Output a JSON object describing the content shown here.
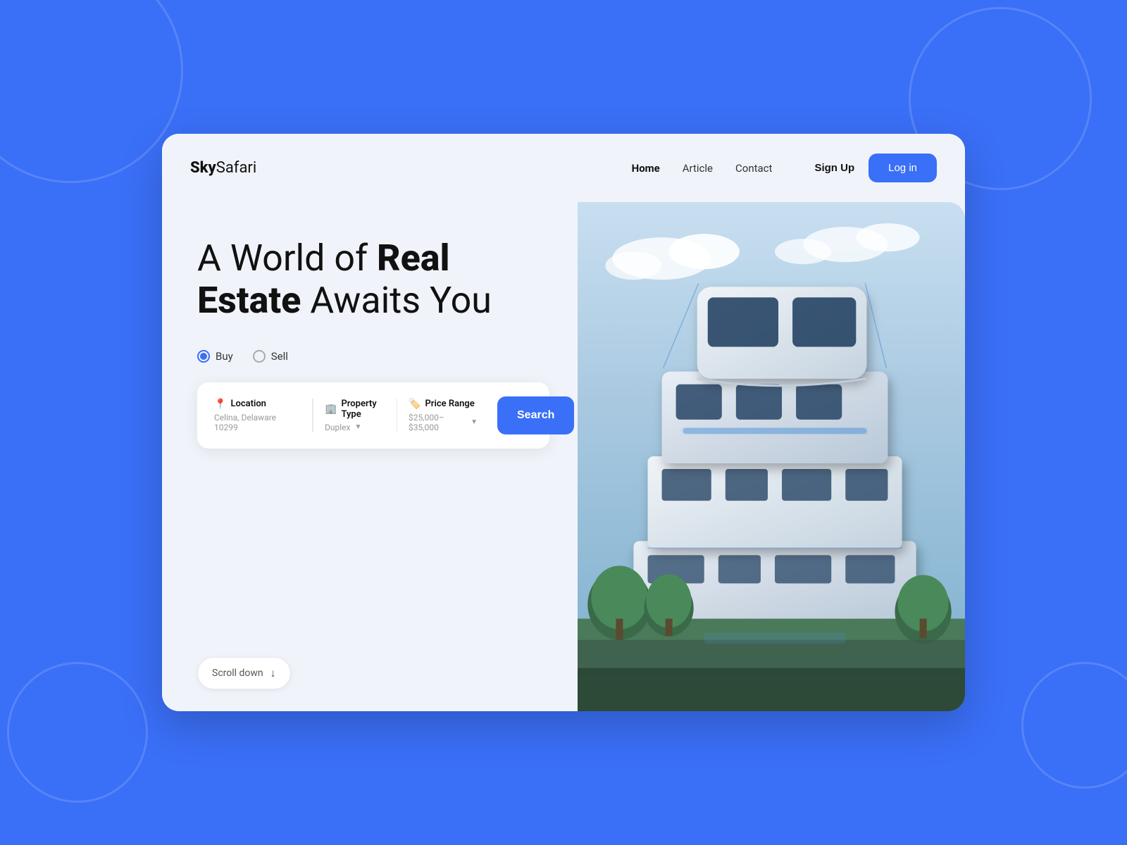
{
  "background": {
    "color": "#3a6ff7"
  },
  "navbar": {
    "logo_regular": "Sky",
    "logo_bold": "Safari",
    "links": [
      {
        "label": "Home",
        "active": true
      },
      {
        "label": "Article",
        "active": false
      },
      {
        "label": "Contact",
        "active": false
      }
    ],
    "signup_label": "Sign Up",
    "login_label": "Log in"
  },
  "hero": {
    "title_part1": "A World of ",
    "title_bold1": "Real",
    "title_part2": "",
    "title_bold2": "Estate",
    "title_part3": " Awaits You"
  },
  "radio": {
    "options": [
      {
        "label": "Buy",
        "checked": true
      },
      {
        "label": "Sell",
        "checked": false
      }
    ]
  },
  "search_bar": {
    "location_label": "Location",
    "location_value": "Celina, Delaware 10299",
    "property_label": "Property Type",
    "property_value": "Duplex",
    "price_label": "Price Range",
    "price_value": "$25,000–$35,000",
    "search_button": "Search"
  },
  "scroll_down": {
    "label": "Scroll down"
  }
}
